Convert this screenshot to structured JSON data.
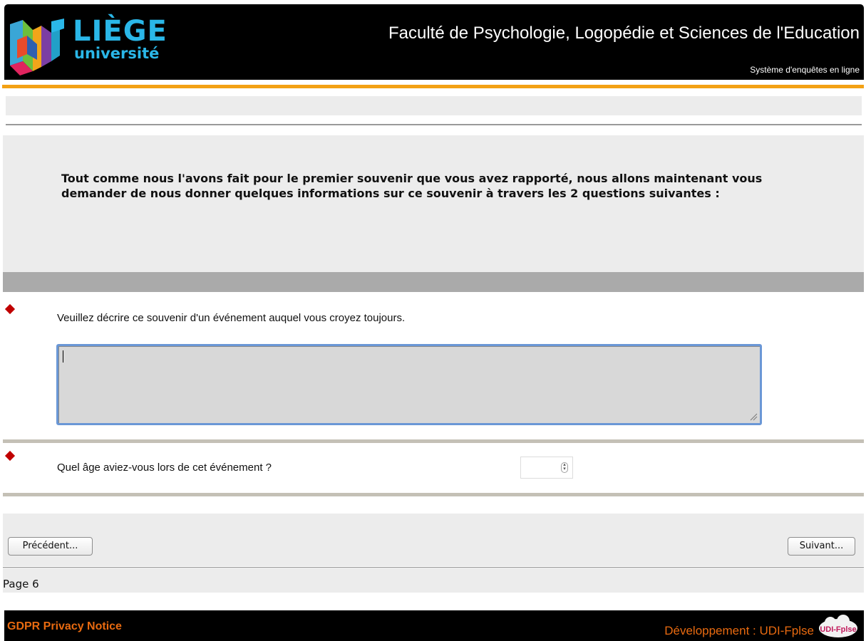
{
  "header": {
    "logo_top": "LIÈGE",
    "logo_bottom": "université",
    "faculty": "Faculté de Psychologie, Logopédie et Sciences de l'Education",
    "subtitle": "Système d'enquêtes en ligne"
  },
  "intro": {
    "text": "Tout comme nous l'avons fait pour le premier souvenir que vous avez rapporté, nous allons maintenant vous demander de nous donner quelques informations sur ce souvenir à travers les 2 questions suivantes :"
  },
  "questions": [
    {
      "label": "Veuillez décrire ce souvenir d'un événement auquel vous croyez toujours.",
      "value": ""
    },
    {
      "label": "Quel âge aviez-vous lors de cet événement ?",
      "value": ""
    }
  ],
  "nav": {
    "prev_label": "Précédent...",
    "next_label": "Suivant...",
    "page_label": "Page 6"
  },
  "footer": {
    "gdpr": "GDPR Privacy Notice",
    "dev": "Développement : UDI-Fplse",
    "dev_logo_text": "UDI-Fplse"
  },
  "colors": {
    "header_bg": "#000000",
    "accent_orange": "#f3a114",
    "logo_blue": "#2ab7e8",
    "footer_text": "#e86a10",
    "required_marker": "#c00000",
    "textarea_focus": "#6a97d6"
  },
  "icons": {
    "logo": "uliege-logo",
    "required": "red-diamond-icon",
    "spinner": "spinner-icon",
    "resize": "resize-grip-icon",
    "dev_logo": "udi-fplse-logo"
  }
}
